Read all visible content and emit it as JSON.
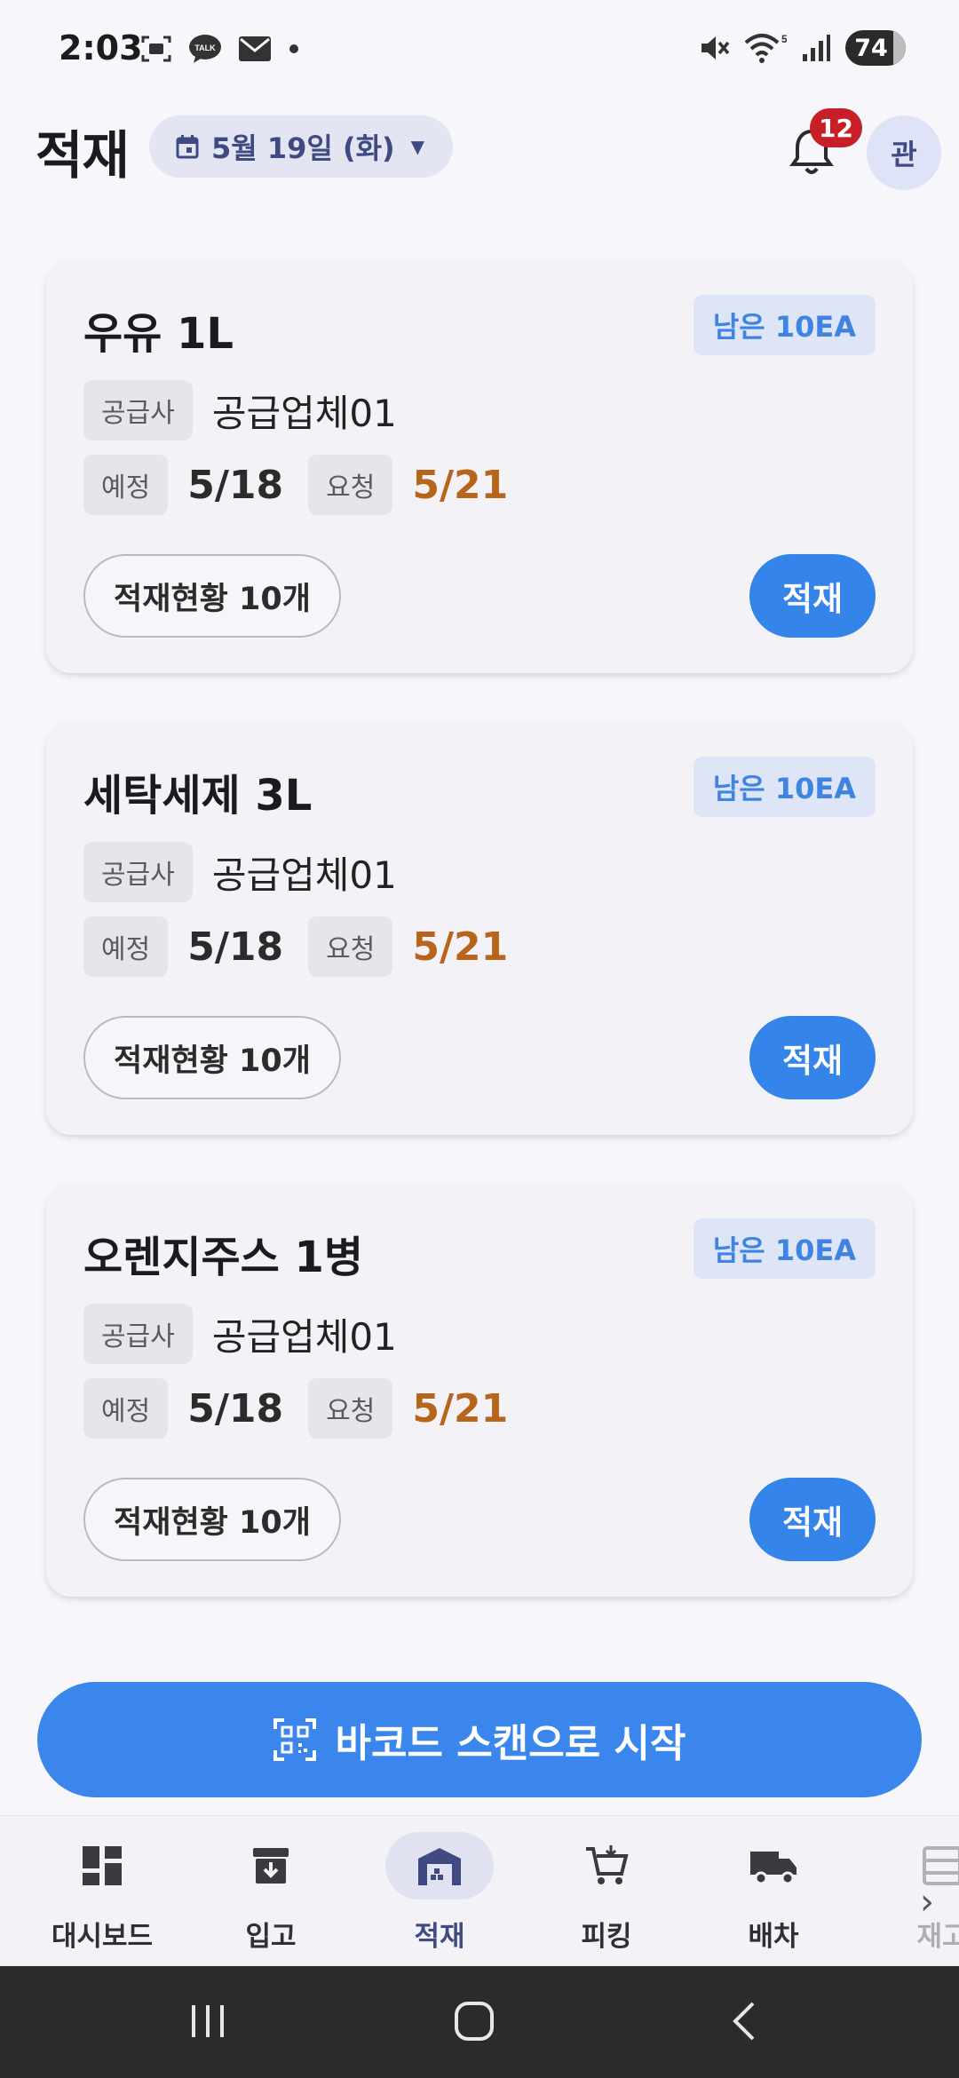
{
  "status_bar": {
    "time": "2:03",
    "battery": "74",
    "left_icons": [
      "screen-capture-icon",
      "kakaotalk-icon",
      "mail-icon",
      "dot-icon"
    ],
    "right_icons": [
      "mute-icon",
      "wifi-icon",
      "signal-icon",
      "battery-icon"
    ]
  },
  "header": {
    "title": "적재",
    "date_label": "5월 19일 (화)",
    "notification_count": "12",
    "avatar_label": "관"
  },
  "cards": [
    {
      "name": "우유 1L",
      "remain": "남은 10EA",
      "supplier_tag": "공급사",
      "supplier": "공급업체01",
      "scheduled_tag": "예정",
      "scheduled_date": "5/18",
      "request_tag": "요청",
      "request_date": "5/21",
      "status_label": "적재현황 10개",
      "action_label": "적재"
    },
    {
      "name": "세탁세제 3L",
      "remain": "남은 10EA",
      "supplier_tag": "공급사",
      "supplier": "공급업체01",
      "scheduled_tag": "예정",
      "scheduled_date": "5/18",
      "request_tag": "요청",
      "request_date": "5/21",
      "status_label": "적재현황 10개",
      "action_label": "적재"
    },
    {
      "name": "오렌지주스 1병",
      "remain": "남은 10EA",
      "supplier_tag": "공급사",
      "supplier": "공급업체01",
      "scheduled_tag": "예정",
      "scheduled_date": "5/18",
      "request_tag": "요청",
      "request_date": "5/21",
      "status_label": "적재현황 10개",
      "action_label": "적재"
    }
  ],
  "scan_button": {
    "label": "바코드 스캔으로 시작"
  },
  "bottom_nav": {
    "items": [
      {
        "label": "대시보드",
        "icon": "dashboard-icon"
      },
      {
        "label": "입고",
        "icon": "inbox-icon"
      },
      {
        "label": "적재",
        "icon": "warehouse-icon",
        "active": true
      },
      {
        "label": "피킹",
        "icon": "cart-icon"
      },
      {
        "label": "배차",
        "icon": "truck-icon"
      },
      {
        "label": "재고",
        "icon": "inventory-icon"
      }
    ]
  },
  "colors": {
    "primary": "#3484e9",
    "accent_navy": "#3f4a82",
    "request_date": "#b8651b",
    "badge_red": "#c62026"
  }
}
